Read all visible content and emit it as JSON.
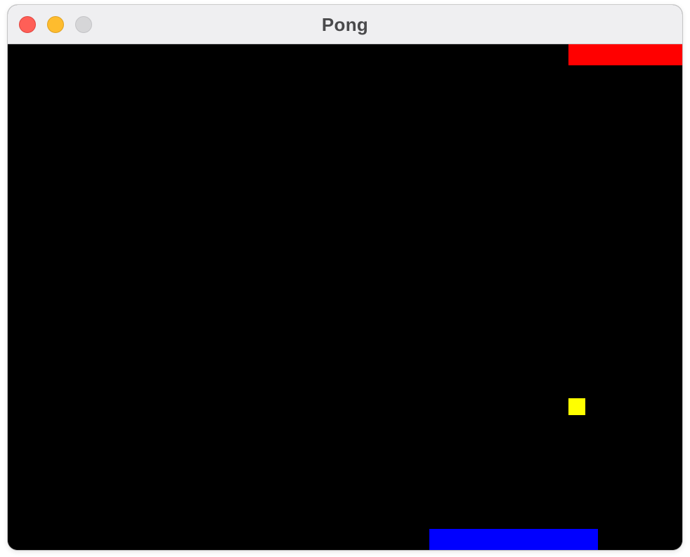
{
  "window": {
    "title": "Pong"
  },
  "controls": {
    "close_icon": "close-icon",
    "minimize_icon": "minimize-icon",
    "zoom_icon": "zoom-icon"
  },
  "game": {
    "background_color": "#000000",
    "top_paddle_color": "#ff0000",
    "bottom_paddle_color": "#0000ff",
    "ball_color": "#ffff00"
  }
}
